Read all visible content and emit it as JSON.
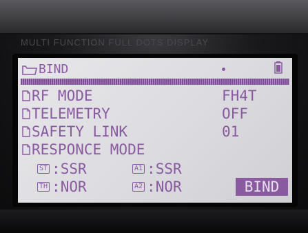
{
  "bezel": {
    "label": "MULTI FUNCTION FULL DOTS DISPLAY"
  },
  "screen": {
    "title": "BIND",
    "icons": {
      "title": "folder-icon",
      "status": "battery-icon",
      "rows": "document-icon"
    },
    "colors": {
      "lcd_text": "#8a5aa0",
      "lcd_background": "#e2e2e6"
    },
    "settings": [
      {
        "label": "RF MODE",
        "value": "FH4T"
      },
      {
        "label": "TELEMETRY",
        "value": "OFF"
      },
      {
        "label": "SAFETY LINK",
        "value": "01"
      },
      {
        "label": "RESPONCE MODE",
        "value": ""
      }
    ],
    "response_modes": [
      {
        "channel": "ST",
        "value": ":SSR"
      },
      {
        "channel": "A1",
        "value": ":SSR"
      },
      {
        "channel": "TH",
        "value": ":NOR"
      },
      {
        "channel": "A2",
        "value": ":NOR"
      }
    ],
    "bind_button": "BIND"
  }
}
